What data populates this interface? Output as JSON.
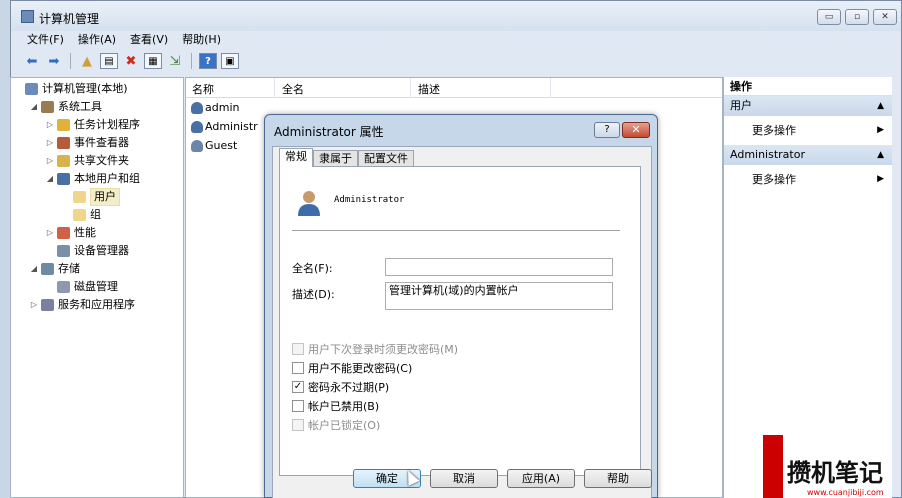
{
  "window": {
    "title": "计算机管理",
    "buttons": {
      "minimize": "▭",
      "maximize": "▫",
      "close": "✕"
    }
  },
  "menu": [
    "文件(F)",
    "操作(A)",
    "查看(V)",
    "帮助(H)"
  ],
  "toolbar": [
    "back-icon",
    "forward-icon",
    "up-icon",
    "show-hide-tree-icon",
    "delete-icon",
    "properties-icon",
    "export-icon",
    "help-icon",
    "console-icon"
  ],
  "tree": [
    {
      "label": "计算机管理(本地)",
      "level": 0,
      "expand": "",
      "icon": "computer-management-icon"
    },
    {
      "label": "系统工具",
      "level": 1,
      "expand": "◢",
      "icon": "tools-icon"
    },
    {
      "label": "任务计划程序",
      "level": 2,
      "expand": "▷",
      "icon": "clock-icon"
    },
    {
      "label": "事件查看器",
      "level": 2,
      "expand": "▷",
      "icon": "event-viewer-icon"
    },
    {
      "label": "共享文件夹",
      "level": 2,
      "expand": "▷",
      "icon": "shared-folder-icon"
    },
    {
      "label": "本地用户和组",
      "level": 2,
      "expand": "◢",
      "icon": "users-groups-icon"
    },
    {
      "label": "用户",
      "level": 3,
      "expand": "",
      "icon": "folder-icon",
      "selected": true
    },
    {
      "label": "组",
      "level": 3,
      "expand": "",
      "icon": "folder-icon"
    },
    {
      "label": "性能",
      "level": 2,
      "expand": "▷",
      "icon": "performance-icon"
    },
    {
      "label": "设备管理器",
      "level": 2,
      "expand": "",
      "icon": "device-manager-icon"
    },
    {
      "label": "存储",
      "level": 1,
      "expand": "◢",
      "icon": "storage-icon"
    },
    {
      "label": "磁盘管理",
      "level": 2,
      "expand": "",
      "icon": "disk-icon"
    },
    {
      "label": "服务和应用程序",
      "level": 1,
      "expand": "▷",
      "icon": "services-icon"
    }
  ],
  "list": {
    "columns": [
      "名称",
      "全名",
      "描述"
    ],
    "rows": [
      "admin",
      "Administr",
      "Guest"
    ]
  },
  "actions": {
    "title": "操作",
    "sections": [
      {
        "name": "用户",
        "item": "更多操作"
      },
      {
        "name": "Administrator",
        "item": "更多操作"
      }
    ]
  },
  "dialog": {
    "title": "Administrator 属性",
    "help": "?",
    "close": "✕",
    "tabs": [
      "常规",
      "隶属于",
      "配置文件"
    ],
    "username": "Administrator",
    "fullname_label": "全名(F):",
    "fullname_value": "",
    "desc_label": "描述(D):",
    "desc_value": "管理计算机(域)的内置帐户",
    "checkboxes": [
      {
        "label": "用户下次登录时须更改密码(M)",
        "checked": false,
        "disabled": true
      },
      {
        "label": "用户不能更改密码(C)",
        "checked": false,
        "disabled": false
      },
      {
        "label": "密码永不过期(P)",
        "checked": true,
        "disabled": false
      },
      {
        "label": "帐户已禁用(B)",
        "checked": false,
        "disabled": false
      },
      {
        "label": "帐户已锁定(O)",
        "checked": false,
        "disabled": true
      }
    ],
    "buttons": [
      "确定",
      "取消",
      "应用(A)",
      "帮助"
    ]
  },
  "watermark": {
    "text": "攒机笔记",
    "sub": "www.cuanjibiji.com"
  }
}
